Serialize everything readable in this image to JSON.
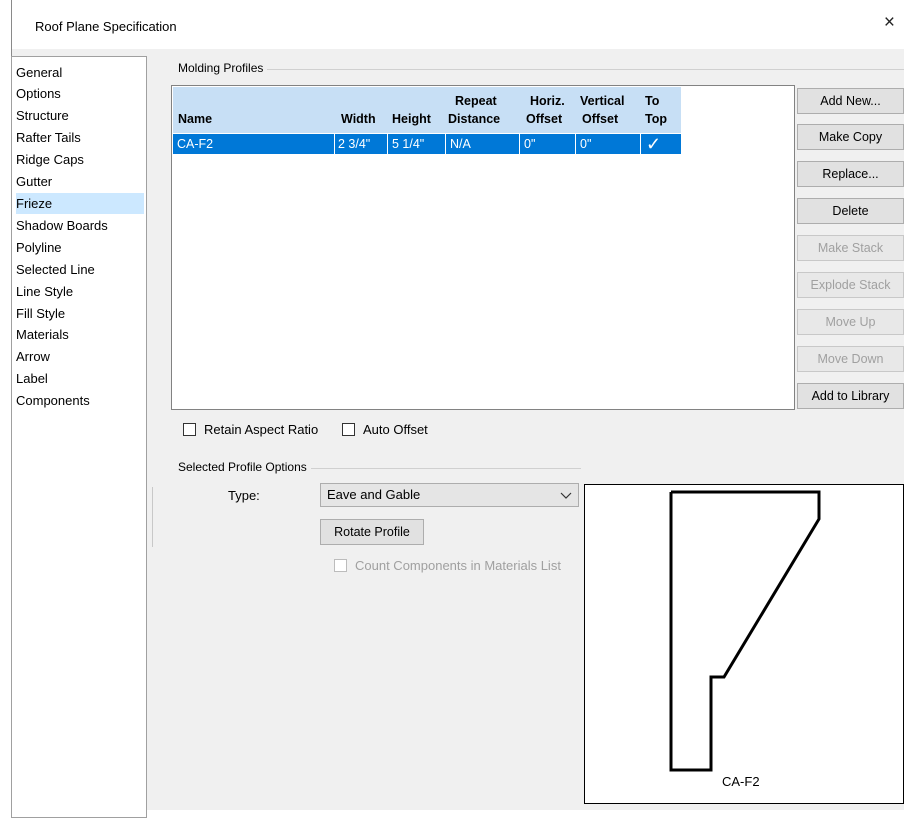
{
  "window": {
    "title": "Roof Plane Specification",
    "close_glyph": "×"
  },
  "sidebar": {
    "items": [
      {
        "label": "General"
      },
      {
        "label": "Options"
      },
      {
        "label": "Structure"
      },
      {
        "label": "Rafter Tails"
      },
      {
        "label": "Ridge Caps"
      },
      {
        "label": "Gutter"
      },
      {
        "label": "Frieze",
        "selected": true
      },
      {
        "label": "Shadow Boards"
      },
      {
        "label": "Polyline"
      },
      {
        "label": "Selected Line"
      },
      {
        "label": "Line Style"
      },
      {
        "label": "Fill Style"
      },
      {
        "label": "Materials"
      },
      {
        "label": "Arrow"
      },
      {
        "label": "Label"
      },
      {
        "label": "Components"
      }
    ]
  },
  "molding": {
    "group_label": "Molding Profiles",
    "columns": {
      "name": "Name",
      "width": "Width",
      "height": "Height",
      "repeat_1": "Repeat",
      "repeat_2": "Distance",
      "horiz_1": "Horiz.",
      "horiz_2": "Offset",
      "vert_1": "Vertical",
      "vert_2": "Offset",
      "top_1": "To",
      "top_2": "Top"
    },
    "rows": [
      {
        "name": "CA-F2",
        "width": "2 3/4\"",
        "height": "5 1/4\"",
        "repeat": "N/A",
        "horiz": "0\"",
        "vert": "0\"",
        "to_top": "✓"
      }
    ],
    "retain_aspect_label": "Retain Aspect Ratio",
    "auto_offset_label": "Auto Offset"
  },
  "buttons": {
    "add_new": "Add New...",
    "make_copy": "Make Copy",
    "replace": "Replace...",
    "delete": "Delete",
    "make_stack": "Make Stack",
    "explode_stack": "Explode Stack",
    "move_up": "Move Up",
    "move_down": "Move Down",
    "add_to_library": "Add to Library"
  },
  "profile_options": {
    "group_label": "Selected Profile Options",
    "type_label": "Type:",
    "type_value": "Eave and Gable",
    "rotate_label": "Rotate Profile",
    "count_components_label": "Count Components in Materials List"
  },
  "preview": {
    "label": "CA-F2"
  },
  "colors": {
    "selection": "#0078d7",
    "sidebar_selection": "#cce8ff",
    "header": "#c7dff5"
  }
}
